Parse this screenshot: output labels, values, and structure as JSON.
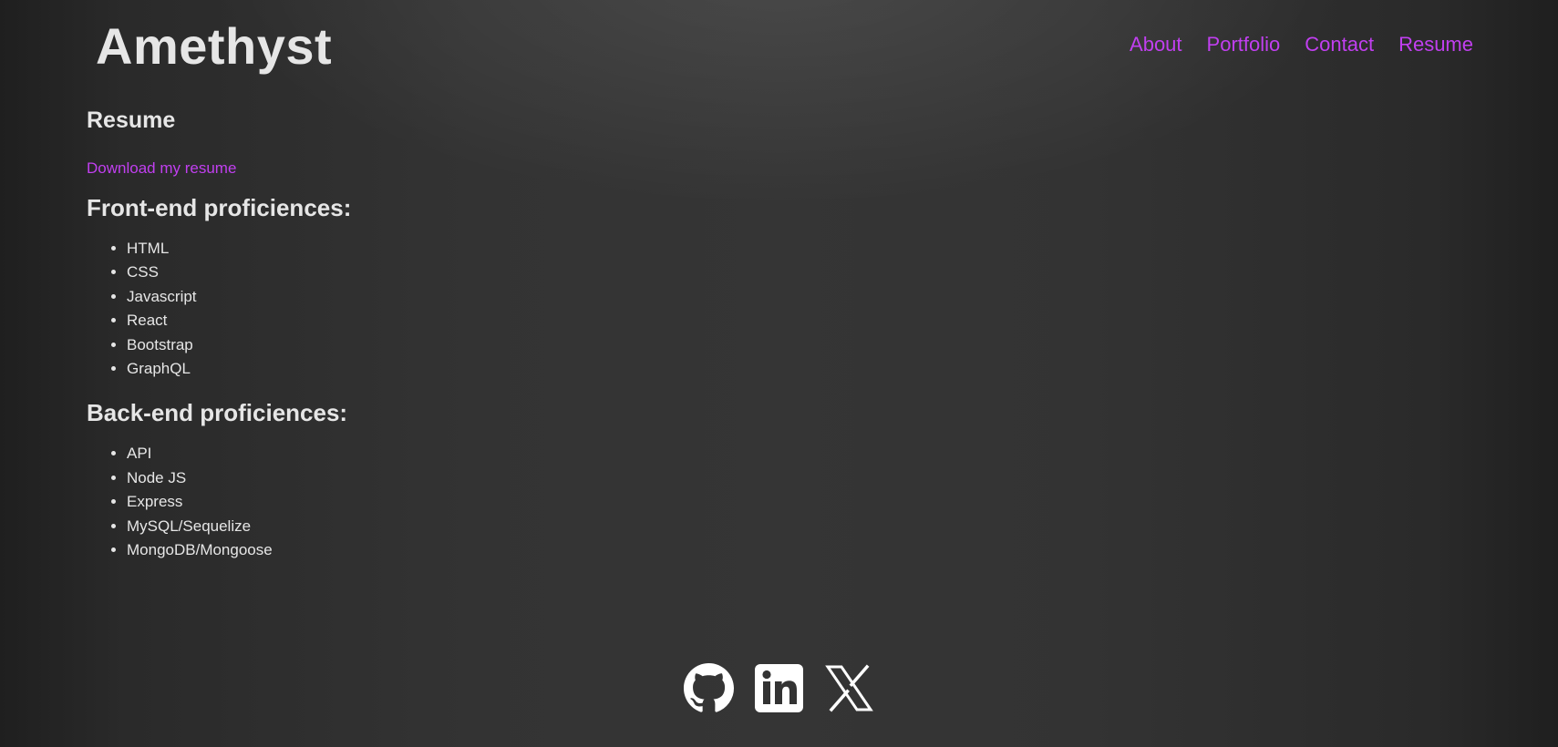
{
  "header": {
    "site_title": "Amethyst",
    "nav": [
      {
        "label": "About"
      },
      {
        "label": "Portfolio"
      },
      {
        "label": "Contact"
      },
      {
        "label": "Resume"
      }
    ]
  },
  "resume": {
    "heading": "Resume",
    "download_label": "Download my resume",
    "frontend": {
      "heading": "Front-end proficiences:",
      "items": [
        "HTML",
        "CSS",
        "Javascript",
        "React",
        "Bootstrap",
        "GraphQL"
      ]
    },
    "backend": {
      "heading": "Back-end proficiences:",
      "items": [
        "API",
        "Node JS",
        "Express",
        "MySQL/Sequelize",
        "MongoDB/Mongoose"
      ]
    }
  },
  "footer": {
    "socials": [
      {
        "icon": "github-icon"
      },
      {
        "icon": "linkedin-icon"
      },
      {
        "icon": "x-icon"
      }
    ]
  },
  "colors": {
    "accent": "#c13ff0",
    "text": "#e6e6e6",
    "background": "#333333"
  }
}
